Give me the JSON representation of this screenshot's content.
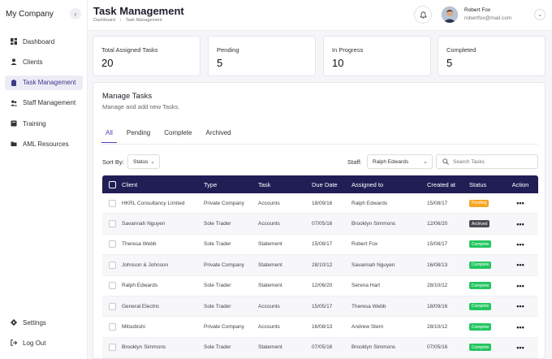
{
  "sidebar": {
    "brand": "My Company",
    "collapse_icon": "chevron-left-icon",
    "items": [
      {
        "label": "Dashboard",
        "icon": "dashboard-icon",
        "active": false
      },
      {
        "label": "Clients",
        "icon": "user-icon",
        "active": false
      },
      {
        "label": "Task Management",
        "icon": "clipboard-icon",
        "active": true
      },
      {
        "label": "Staff Management",
        "icon": "users-icon",
        "active": false
      },
      {
        "label": "Training",
        "icon": "book-icon",
        "active": false
      },
      {
        "label": "AML Resources",
        "icon": "folder-icon",
        "active": false
      }
    ],
    "bottom": [
      {
        "label": "Settings",
        "icon": "gear-icon"
      },
      {
        "label": "Log Out",
        "icon": "logout-icon"
      }
    ]
  },
  "header": {
    "title": "Task Management",
    "breadcrumb": [
      "Dashboard",
      "Task Management"
    ],
    "user_name": "Robert Fox",
    "user_email": "robertfox@mail.com"
  },
  "stats": [
    {
      "label": "Total Assigned Tasks",
      "value": "20"
    },
    {
      "label": "Pending",
      "value": "5"
    },
    {
      "label": "In Progress",
      "value": "10"
    },
    {
      "label": "Completed",
      "value": "5"
    }
  ],
  "panel": {
    "title": "Manage Tasks",
    "subtitle": "Manage and add new Tasks.",
    "tabs": [
      "All",
      "Pending",
      "Complete",
      "Archived"
    ],
    "sort_label": "Sort By:",
    "sort_value": "Status",
    "staff_label": "Staff:",
    "staff_value": "Ralph Edwards",
    "search_placeholder": "Search Tasks"
  },
  "table": {
    "columns": [
      "Client",
      "Type",
      "Task",
      "Due Date",
      "Assigned to",
      "Created at",
      "Status",
      "Action"
    ],
    "rows": [
      {
        "client": "HKRL Consultancy Limited",
        "type": "Private Company",
        "task": "Accounts",
        "due": "18/09/16",
        "assigned": "Ralph Edwards",
        "created": "15/08/17",
        "status": "Pending"
      },
      {
        "client": "Savannah Nguyen",
        "type": "Sole Trader",
        "task": "Accounts",
        "due": "07/05/16",
        "assigned": "Brooklyn Simmons",
        "created": "12/06/20",
        "status": "Archived"
      },
      {
        "client": "Theresa Webb",
        "type": "Sole Trader",
        "task": "Statement",
        "due": "15/08/17",
        "assigned": "Robert Fox",
        "created": "15/08/17",
        "status": "Complete"
      },
      {
        "client": "Johnson & Johnson",
        "type": "Private Company",
        "task": "Statement",
        "due": "28/10/12",
        "assigned": "Savannah Nguyen",
        "created": "16/08/13",
        "status": "Complete"
      },
      {
        "client": "Ralph Edwards",
        "type": "Sole Trader",
        "task": "Statement",
        "due": "12/06/20",
        "assigned": "Serena Hart",
        "created": "28/10/12",
        "status": "Complete"
      },
      {
        "client": "General Electric",
        "type": "Sole Trader",
        "task": "Accounts",
        "due": "15/05/17",
        "assigned": "Theresa Webb",
        "created": "18/09/16",
        "status": "Complete"
      },
      {
        "client": "Mitsubishi",
        "type": "Private Company",
        "task": "Accounts",
        "due": "16/08/13",
        "assigned": "Andrew Stern",
        "created": "28/10/12",
        "status": "Complete"
      },
      {
        "client": "Brooklyn Simmons",
        "type": "Sole Trader",
        "task": "Statement",
        "due": "07/05/16",
        "assigned": "Brooklyn Simmons",
        "created": "07/05/16",
        "status": "Complete"
      }
    ],
    "action_label": "•••"
  },
  "colors": {
    "accent": "#4a45b5",
    "table_header": "#211d55",
    "pending": "#f5a623",
    "archived": "#4a4a52",
    "complete": "#22c55e"
  }
}
